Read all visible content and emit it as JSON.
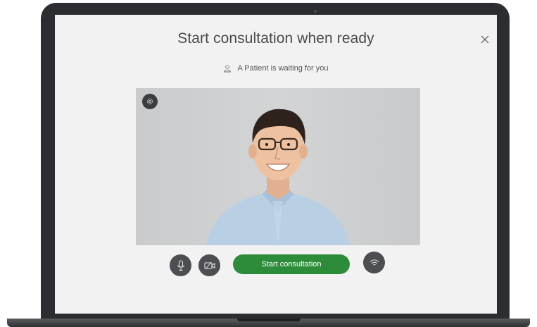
{
  "dialog": {
    "title": "Start consultation when ready",
    "waiting_text": "A Patient is waiting for you"
  },
  "icons": {
    "close": "close-icon",
    "user": "user-icon",
    "settings": "gear-icon",
    "microphone": "microphone-icon",
    "camera": "video-camera-icon",
    "network": "wifi-icon"
  },
  "controls": {
    "start_label": "Start consultation"
  },
  "colors": {
    "start_button": "#2c8c3a",
    "control_button": "#4c4e52",
    "screen_background": "#f2f2f2",
    "bezel": "#2b2d31"
  }
}
